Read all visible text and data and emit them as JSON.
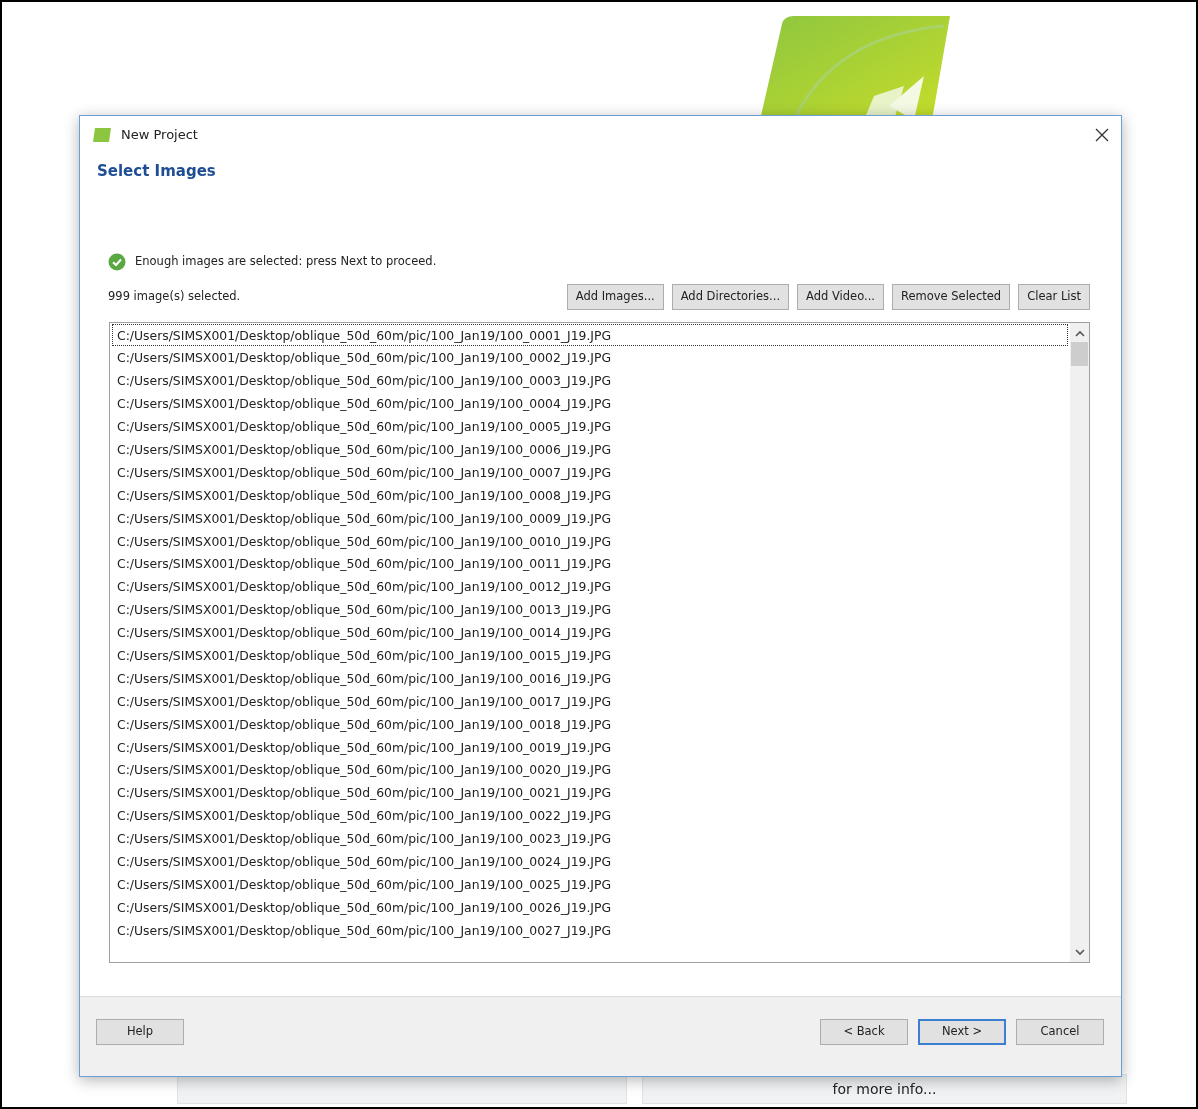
{
  "background": {
    "info_text": "for more info..."
  },
  "window": {
    "title": "New Project"
  },
  "page_title": "Select Images",
  "status": {
    "kind": "ok",
    "message": "Enough images are selected: press Next to proceed."
  },
  "count_label": "999 image(s) selected.",
  "toolbar": [
    "Add Images...",
    "Add Directories...",
    "Add Video...",
    "Remove Selected",
    "Clear List"
  ],
  "files": [
    {
      "path": "C:/Users/SIMSX001/Desktop/oblique_50d_60m/pic/100_Jan19/100_0001_J19.JPG",
      "focused": true
    },
    {
      "path": "C:/Users/SIMSX001/Desktop/oblique_50d_60m/pic/100_Jan19/100_0002_J19.JPG",
      "focused": false
    },
    {
      "path": "C:/Users/SIMSX001/Desktop/oblique_50d_60m/pic/100_Jan19/100_0003_J19.JPG",
      "focused": false
    },
    {
      "path": "C:/Users/SIMSX001/Desktop/oblique_50d_60m/pic/100_Jan19/100_0004_J19.JPG",
      "focused": false
    },
    {
      "path": "C:/Users/SIMSX001/Desktop/oblique_50d_60m/pic/100_Jan19/100_0005_J19.JPG",
      "focused": false
    },
    {
      "path": "C:/Users/SIMSX001/Desktop/oblique_50d_60m/pic/100_Jan19/100_0006_J19.JPG",
      "focused": false
    },
    {
      "path": "C:/Users/SIMSX001/Desktop/oblique_50d_60m/pic/100_Jan19/100_0007_J19.JPG",
      "focused": false
    },
    {
      "path": "C:/Users/SIMSX001/Desktop/oblique_50d_60m/pic/100_Jan19/100_0008_J19.JPG",
      "focused": false
    },
    {
      "path": "C:/Users/SIMSX001/Desktop/oblique_50d_60m/pic/100_Jan19/100_0009_J19.JPG",
      "focused": false
    },
    {
      "path": "C:/Users/SIMSX001/Desktop/oblique_50d_60m/pic/100_Jan19/100_0010_J19.JPG",
      "focused": false
    },
    {
      "path": "C:/Users/SIMSX001/Desktop/oblique_50d_60m/pic/100_Jan19/100_0011_J19.JPG",
      "focused": false
    },
    {
      "path": "C:/Users/SIMSX001/Desktop/oblique_50d_60m/pic/100_Jan19/100_0012_J19.JPG",
      "focused": false
    },
    {
      "path": "C:/Users/SIMSX001/Desktop/oblique_50d_60m/pic/100_Jan19/100_0013_J19.JPG",
      "focused": false
    },
    {
      "path": "C:/Users/SIMSX001/Desktop/oblique_50d_60m/pic/100_Jan19/100_0014_J19.JPG",
      "focused": false
    },
    {
      "path": "C:/Users/SIMSX001/Desktop/oblique_50d_60m/pic/100_Jan19/100_0015_J19.JPG",
      "focused": false
    },
    {
      "path": "C:/Users/SIMSX001/Desktop/oblique_50d_60m/pic/100_Jan19/100_0016_J19.JPG",
      "focused": false
    },
    {
      "path": "C:/Users/SIMSX001/Desktop/oblique_50d_60m/pic/100_Jan19/100_0017_J19.JPG",
      "focused": false
    },
    {
      "path": "C:/Users/SIMSX001/Desktop/oblique_50d_60m/pic/100_Jan19/100_0018_J19.JPG",
      "focused": false
    },
    {
      "path": "C:/Users/SIMSX001/Desktop/oblique_50d_60m/pic/100_Jan19/100_0019_J19.JPG",
      "focused": false
    },
    {
      "path": "C:/Users/SIMSX001/Desktop/oblique_50d_60m/pic/100_Jan19/100_0020_J19.JPG",
      "focused": false
    },
    {
      "path": "C:/Users/SIMSX001/Desktop/oblique_50d_60m/pic/100_Jan19/100_0021_J19.JPG",
      "focused": false
    },
    {
      "path": "C:/Users/SIMSX001/Desktop/oblique_50d_60m/pic/100_Jan19/100_0022_J19.JPG",
      "focused": false
    },
    {
      "path": "C:/Users/SIMSX001/Desktop/oblique_50d_60m/pic/100_Jan19/100_0023_J19.JPG",
      "focused": false
    },
    {
      "path": "C:/Users/SIMSX001/Desktop/oblique_50d_60m/pic/100_Jan19/100_0024_J19.JPG",
      "focused": false
    },
    {
      "path": "C:/Users/SIMSX001/Desktop/oblique_50d_60m/pic/100_Jan19/100_0025_J19.JPG",
      "focused": false
    },
    {
      "path": "C:/Users/SIMSX001/Desktop/oblique_50d_60m/pic/100_Jan19/100_0026_J19.JPG",
      "focused": false
    },
    {
      "path": "C:/Users/SIMSX001/Desktop/oblique_50d_60m/pic/100_Jan19/100_0027_J19.JPG",
      "focused": false
    }
  ],
  "footer": {
    "left": [
      {
        "label": "Help",
        "default": false
      }
    ],
    "right": [
      {
        "label": "< Back",
        "default": false
      },
      {
        "label": "Next >",
        "default": true
      },
      {
        "label": "Cancel",
        "default": false
      }
    ]
  }
}
